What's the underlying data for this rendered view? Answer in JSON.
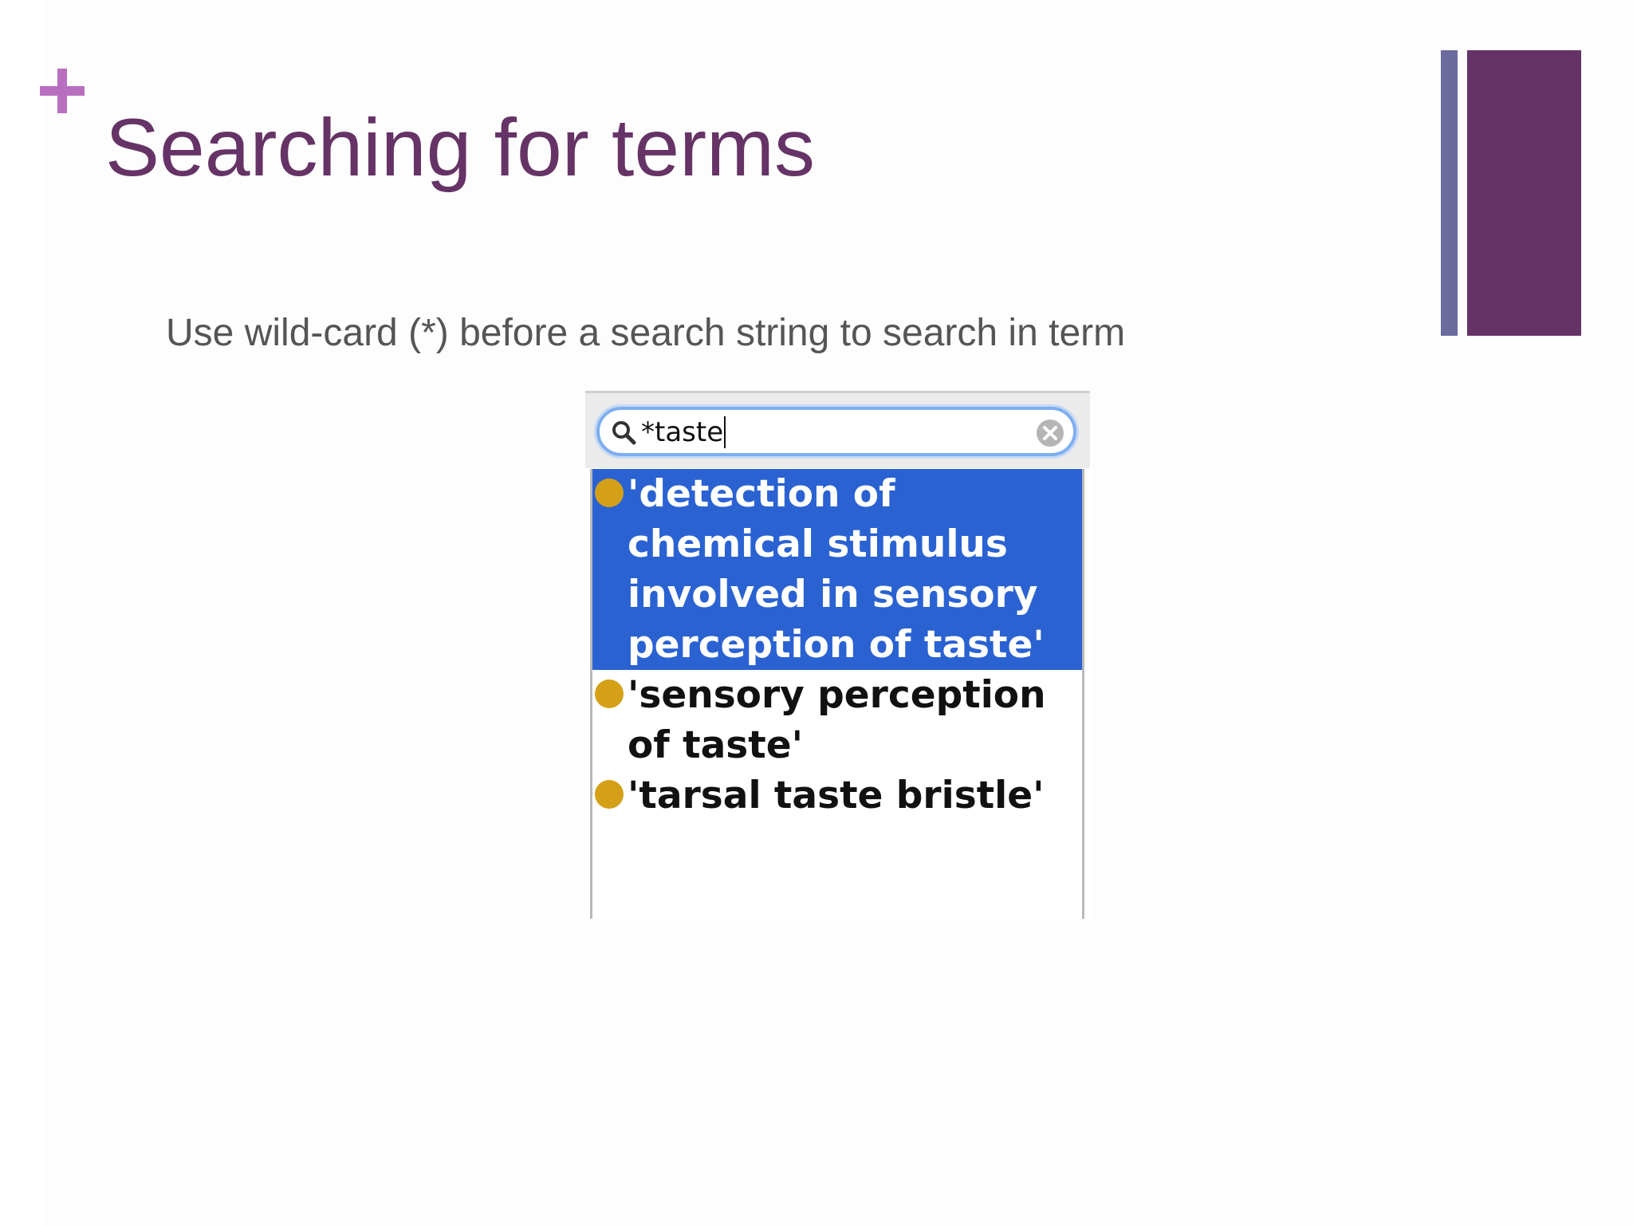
{
  "slide": {
    "title": "Searching for terms",
    "body": "Use wild-card (*) before a search string to search in term",
    "colors": {
      "title": "#663366",
      "plus_mark": "#b86fc0",
      "accent_bar_thin": "#6b6b9e",
      "accent_bar_thick": "#663366",
      "body_text": "#555555"
    }
  },
  "search": {
    "value": "*taste",
    "icon": "magnifier-icon",
    "clear_icon": "clear-x-icon",
    "focus_ring_color": "#7eaef0"
  },
  "results": {
    "selection_color": "#2a62d2",
    "bullet_color": "#d4a017",
    "items": [
      {
        "label": "'detection of chemical stimulus involved in sensory perception of taste'",
        "selected": true
      },
      {
        "label": "'sensory perception of taste'",
        "selected": false
      },
      {
        "label": "'tarsal taste bristle'",
        "selected": false
      }
    ]
  }
}
